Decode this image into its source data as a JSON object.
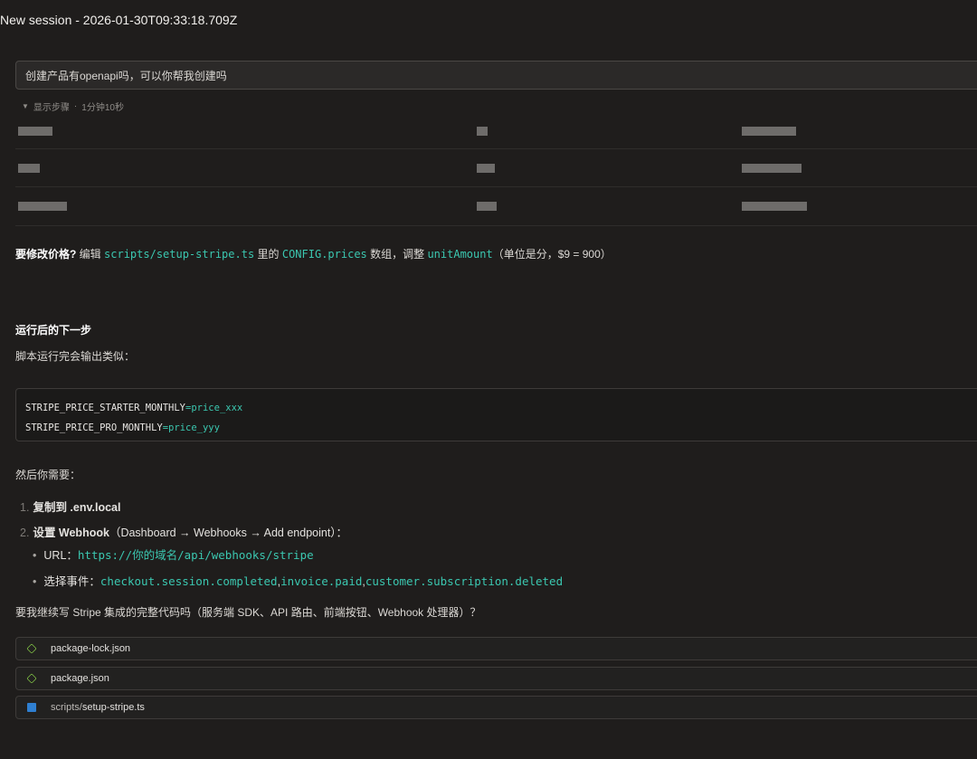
{
  "title": "New session - 2026-01-30T09:33:18.709Z",
  "prompt": "创建产品有openapi吗，可以你帮我创建吗",
  "steps": {
    "caret": "▼",
    "label": "显示步骤",
    "sep": "·",
    "duration": "1分钟10秒"
  },
  "price_note": {
    "bold": "要修改价格?",
    "t1": " 编辑 ",
    "c1": "scripts/setup-stripe.ts",
    "t2": " 里的 ",
    "c2": "CONFIG.prices",
    "t3": " 数组，调整 ",
    "c3": "unitAmount",
    "t4": "（单位是分，$9 = 900）"
  },
  "next_heading": "运行后的下一步",
  "next_intro": "脚本运行完会输出类似：",
  "code_lines": [
    {
      "key": "STRIPE_PRICE_STARTER_MONTHLY",
      "eq": "=",
      "val": "price_xxx"
    },
    {
      "key": "STRIPE_PRICE_PRO_MONTHLY",
      "eq": "=",
      "val": "price_yyy"
    }
  ],
  "then_need": "然后你需要：",
  "list": [
    {
      "num": "1.",
      "bold": "复制到 .env.local",
      "rest": ""
    },
    {
      "num": "2.",
      "bold": "设置 Webhook",
      "rest": "（Dashboard → Webhooks → Add endpoint）："
    }
  ],
  "sub_list": {
    "url_label": "URL：",
    "url_value": "https://你的域名/api/webhooks/stripe",
    "events_label": "选择事件：",
    "e1": "checkout.session.completed",
    "e2": "invoice.paid",
    "e3": "customer.subscription.deleted",
    "comma": ","
  },
  "question": "要我继续写 Stripe 集成的完整代码吗（服务端 SDK、API 路由、前端按钮、Webhook 处理器）？",
  "files": [
    {
      "icon": "nodejs-icon",
      "dir": "",
      "name": "package-lock.json"
    },
    {
      "icon": "nodejs-icon",
      "dir": "",
      "name": "package.json"
    },
    {
      "icon": "typescript-file-icon",
      "dir": "scripts/",
      "name": "setup-stripe.ts"
    }
  ],
  "colors": {
    "background": "#1f1d1c",
    "code_accent": "#3bc7b0",
    "node_icon": "#7fbf45",
    "ts_icon": "#2f7fd1"
  }
}
